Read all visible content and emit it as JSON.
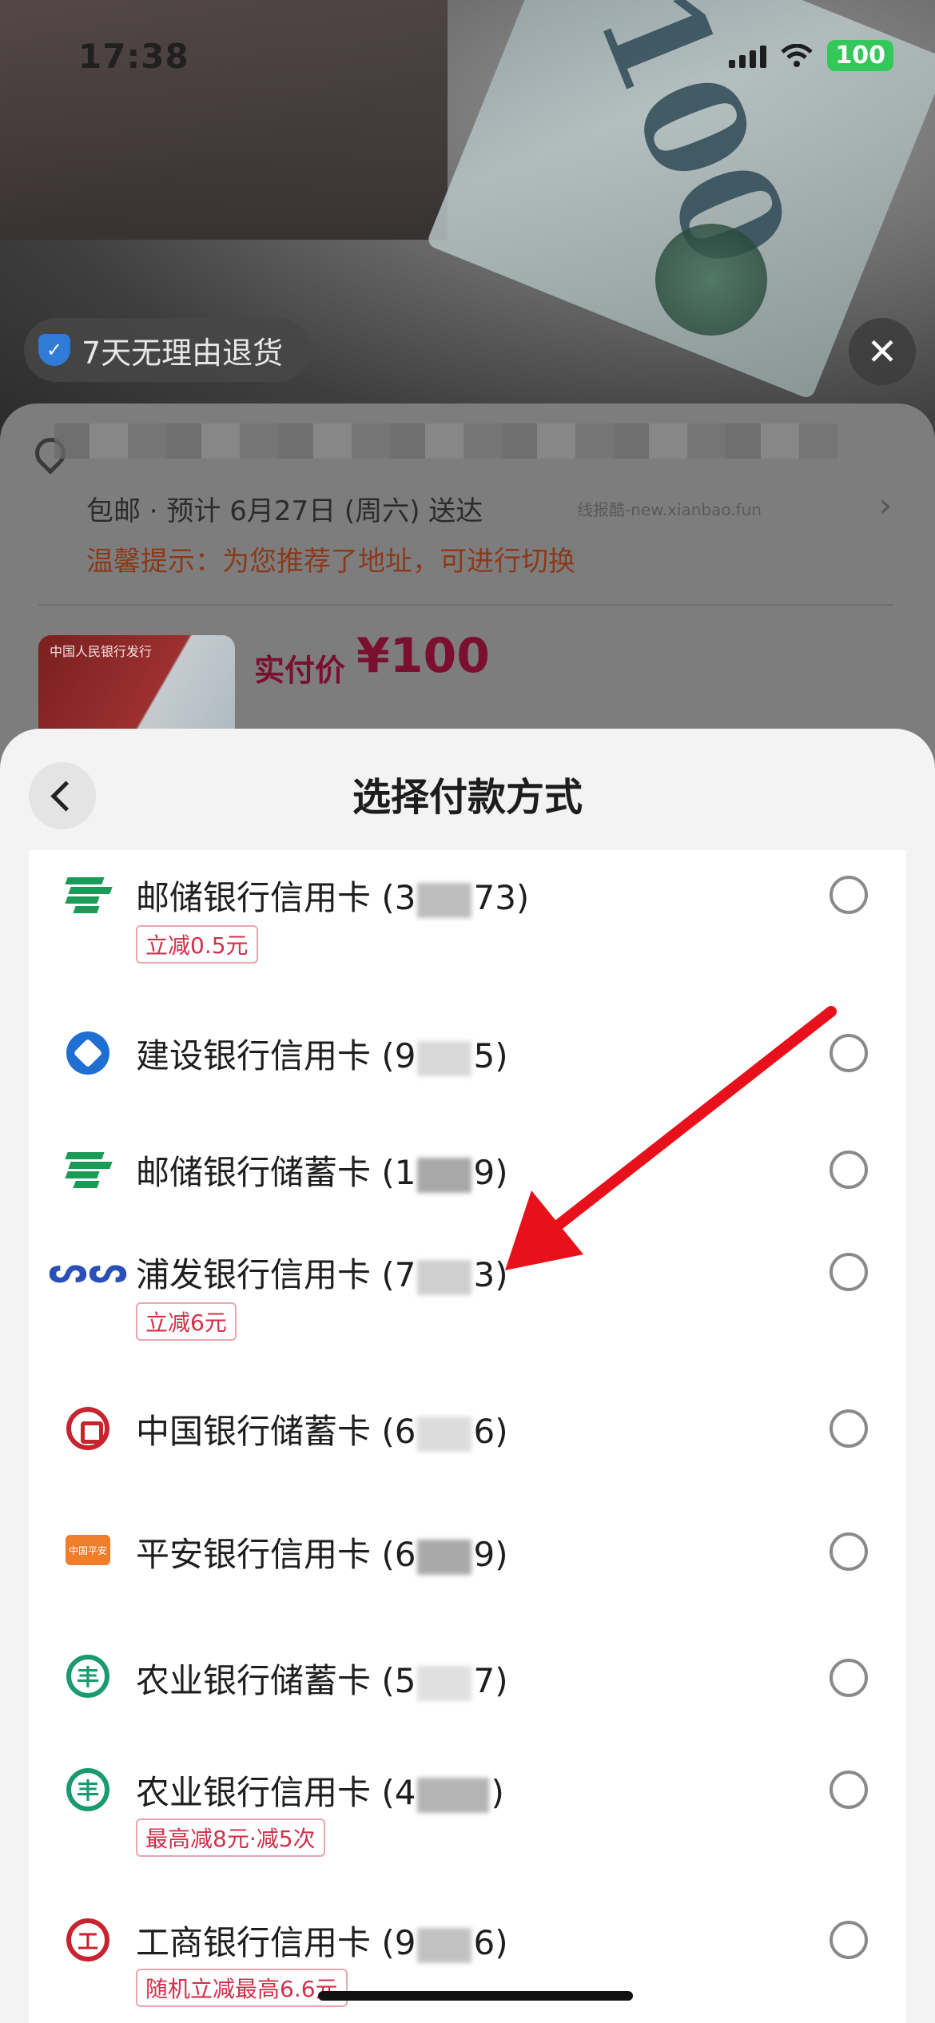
{
  "status_bar": {
    "time": "17:38",
    "battery": "100"
  },
  "header_overlay": {
    "return_policy": "7天无理由退货"
  },
  "order": {
    "shipping": "包邮 · 预计 6月27日 (周六) 送达",
    "watermark": "线报酷-new.xianbao.fun",
    "tip": "温馨提示：为您推荐了地址，可进行切换",
    "thumb_label": "中国人民银行发行",
    "price_label": "实付价",
    "price_value": "¥100"
  },
  "sheet": {
    "title": "选择付款方式",
    "methods": [
      {
        "icon": "psbc-icon",
        "name_prefix": "邮储银行信用卡 (3",
        "name_suffix": "73)",
        "promo": "立减0.5元"
      },
      {
        "icon": "ccb-icon",
        "name_prefix": "建设银行信用卡 (9",
        "name_suffix": "5)",
        "promo": ""
      },
      {
        "icon": "psbc-icon",
        "name_prefix": "邮储银行储蓄卡 (1",
        "name_suffix": "9)",
        "promo": ""
      },
      {
        "icon": "spdb-icon",
        "name_prefix": "浦发银行信用卡 (7",
        "name_suffix": "3)",
        "promo": "立减6元"
      },
      {
        "icon": "boc-icon",
        "name_prefix": "中国银行储蓄卡 (6",
        "name_suffix": "6)",
        "promo": ""
      },
      {
        "icon": "pingan-icon",
        "name_prefix": "平安银行信用卡 (6",
        "name_suffix": "9)",
        "promo": ""
      },
      {
        "icon": "abc-icon",
        "name_prefix": "农业银行储蓄卡 (5",
        "name_suffix": "7)",
        "promo": ""
      },
      {
        "icon": "abc-icon",
        "name_prefix": "农业银行信用卡 (4",
        "name_suffix": ")",
        "promo": "最高减8元·减5次"
      },
      {
        "icon": "icbc-icon",
        "name_prefix": "工商银行信用卡 (9",
        "name_suffix": "6)",
        "promo": "随机立减最高6.6元"
      }
    ]
  },
  "icons": {
    "pingan_label": "中国平安"
  },
  "colors": {
    "accent_red": "#e8111b",
    "promo_red": "#d0304a",
    "price_red": "#7b0f30"
  }
}
